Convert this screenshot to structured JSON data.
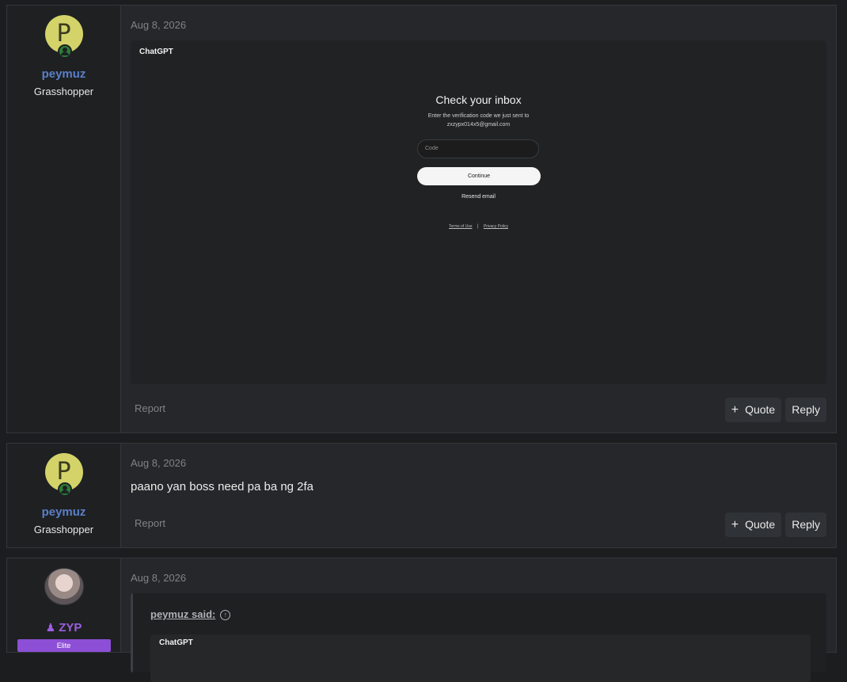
{
  "posts": [
    {
      "user": {
        "initial": "P",
        "name": "peymuz",
        "title": "Grasshopper"
      },
      "date": "Aug 8, 2026",
      "attachment": {
        "brand": "ChatGPT",
        "heading": "Check your inbox",
        "subtitle_line1": "Enter the verification code we just sent to",
        "subtitle_line2": "zxzypx014x5@gmail.com",
        "code_placeholder": "Code",
        "continue_label": "Continue",
        "resend_label": "Resend email",
        "terms_label": "Terms of Use",
        "separator": "|",
        "privacy_label": "Privacy Policy"
      },
      "actions": {
        "report": "Report",
        "quote": "Quote",
        "reply": "Reply"
      }
    },
    {
      "user": {
        "initial": "P",
        "name": "peymuz",
        "title": "Grasshopper"
      },
      "date": "Aug 8, 2026",
      "message": "paano yan boss need pa ba ng 2fa",
      "actions": {
        "report": "Report",
        "quote": "Quote",
        "reply": "Reply"
      }
    },
    {
      "user": {
        "name": "ZYP",
        "banner": "Elite"
      },
      "date": "Aug 8, 2026",
      "quote": {
        "author": "peymuz said:",
        "inner_brand": "ChatGPT"
      }
    }
  ],
  "icons": {
    "online": "user-online-icon",
    "plus": "plus-icon",
    "quote_up": "arrow-up-circle-icon",
    "user_role": "user-icon"
  },
  "colors": {
    "username_blue": "#5b7fc7",
    "username_purple": "#9c5fe0",
    "banner_purple": "#8d4fd6",
    "avatar_yellow": "#d3d369"
  }
}
